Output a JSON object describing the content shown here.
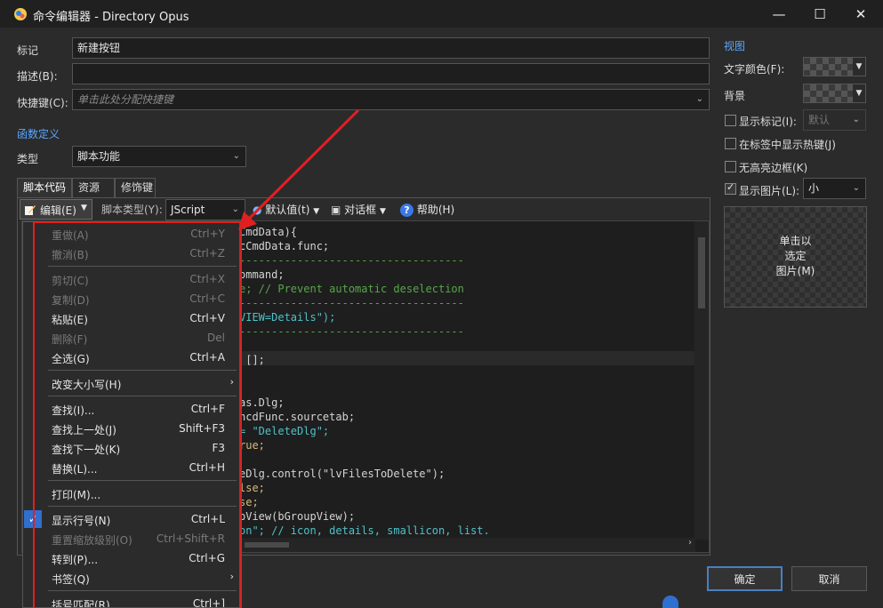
{
  "window": {
    "title": "命令编辑器 - Directory Opus",
    "min": "—",
    "max": "☐",
    "close": "✕"
  },
  "form": {
    "label_label": "标记",
    "label_value": "新建按钮",
    "desc_label": "描述(B):",
    "desc_value": "",
    "hotkey_label": "快捷键(C):",
    "hotkey_placeholder": "单击此处分配快捷键",
    "funcdef_heading": "函数定义",
    "type_label": "类型",
    "type_value": "脚本功能"
  },
  "tabs": [
    "脚本代码",
    "资源",
    "修饰键"
  ],
  "toolbar": {
    "edit": "编辑(E)",
    "script_type_label": "脚本类型(Y):",
    "script_type_value": "JScript",
    "defaults": "默认值(t)",
    "dialog": "对话框",
    "help": "帮助(H)"
  },
  "code": [
    "CmdData){",
    "cCmdData.func;",
    "-----------------------------------",
    "ommand;",
    "e; // Prevent automatic deselection",
    "-----------------------------------",
    "VIEW=Details\");",
    "-----------------------------------",
    "",
    " [];",
    "",
    "",
    "as.Dlg;",
    "ncdFunc.sourcetab;",
    "= \"DeleteDlg\";",
    "rue;",
    "",
    "eDlg.control(\"lvFilesToDelete\");",
    "lse;",
    "se;",
    "pView(bGroupView);",
    "on\"; // icon, details, smallicon, list."
  ],
  "view": {
    "heading": "视图",
    "text_color": "文字颜色(F):",
    "background": "背景",
    "show_label": "显示标记(I):",
    "show_label_value": "默认",
    "show_hotkey": "在标签中显示热键(J)",
    "no_highlight": "无高亮边框(K)",
    "show_image": "显示图片(L):",
    "show_image_value": "小",
    "image_box": [
      "单击以",
      "选定",
      "图片(M)"
    ]
  },
  "buttons": {
    "ok": "确定",
    "cancel": "取消"
  },
  "menu": [
    {
      "label": "重做(A)",
      "key": "Ctrl+Y",
      "disabled": true
    },
    {
      "label": "撤消(B)",
      "key": "Ctrl+Z",
      "disabled": true
    },
    {
      "label": "剪切(C)",
      "key": "Ctrl+X",
      "disabled": true
    },
    {
      "label": "复制(D)",
      "key": "Ctrl+C",
      "disabled": true
    },
    {
      "label": "粘贴(E)",
      "key": "Ctrl+V",
      "disabled": false
    },
    {
      "label": "删除(F)",
      "key": "Del",
      "disabled": true
    },
    {
      "label": "全选(G)",
      "key": "Ctrl+A",
      "disabled": false
    },
    {
      "label": "改变大小写(H)",
      "key": "",
      "disabled": false
    },
    {
      "label": "查找(I)...",
      "key": "Ctrl+F",
      "disabled": false
    },
    {
      "label": "查找上一处(J)",
      "key": "Shift+F3",
      "disabled": false
    },
    {
      "label": "查找下一处(K)",
      "key": "F3",
      "disabled": false
    },
    {
      "label": "替换(L)...",
      "key": "Ctrl+H",
      "disabled": false
    },
    {
      "label": "打印(M)...",
      "key": "",
      "disabled": false
    },
    {
      "label": "显示行号(N)",
      "key": "Ctrl+L",
      "disabled": false
    },
    {
      "label": "重置缩放级别(O)",
      "key": "Ctrl+Shift+R",
      "disabled": true
    },
    {
      "label": "转到(P)...",
      "key": "Ctrl+G",
      "disabled": false
    },
    {
      "label": "书签(Q)",
      "key": "",
      "disabled": false
    },
    {
      "label": "括号匹配(R)",
      "key": "Ctrl+]",
      "disabled": false
    }
  ],
  "colors": {
    "accent": "#5aa6ff",
    "highlight": "#e02020"
  }
}
